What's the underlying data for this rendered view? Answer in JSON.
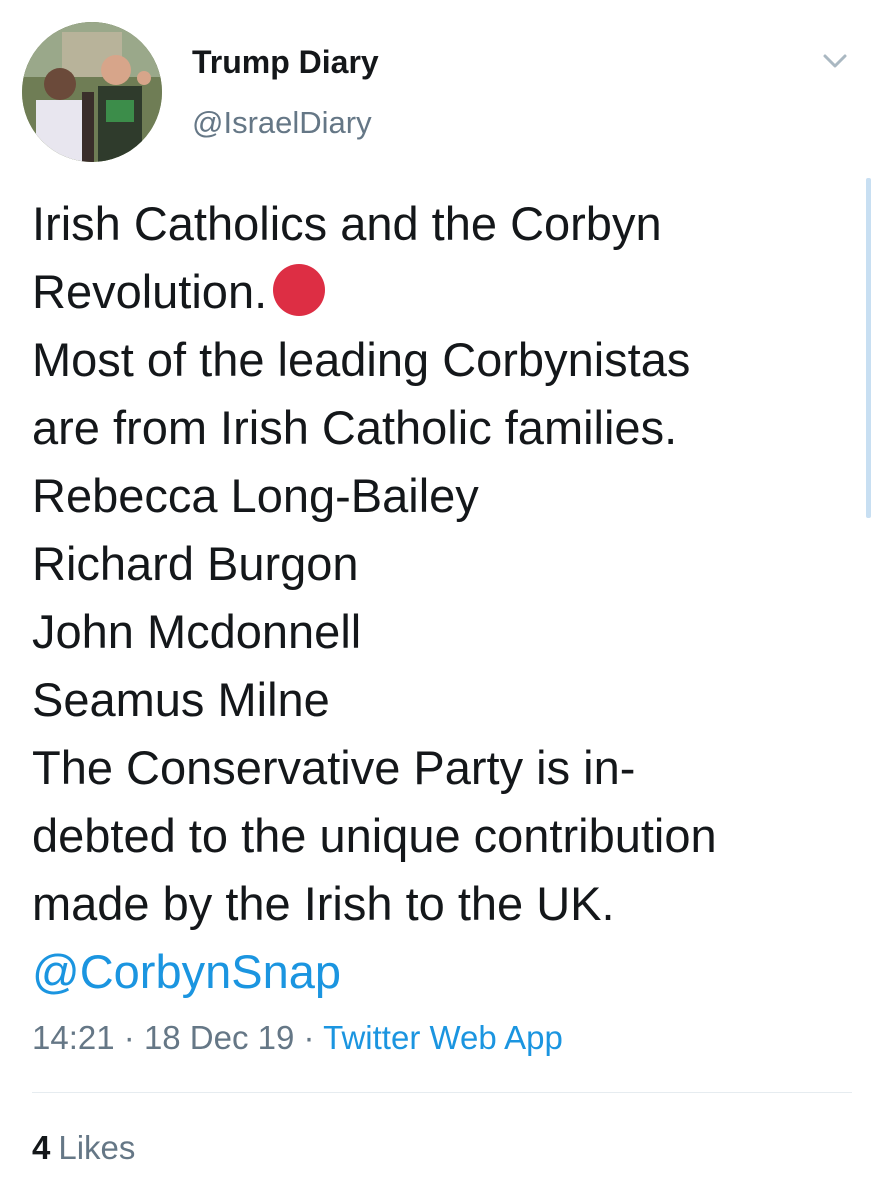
{
  "author": {
    "display_name": "Trump Diary",
    "handle": "@IsraelDiary"
  },
  "icons": {
    "menu": "chevron-down-icon",
    "emoji": "red-circle-icon"
  },
  "tweet": {
    "lines": [
      "Irish Catholics and the Corbyn",
      "Revolution.",
      "Most of the leading Corbynistas",
      "are from Irish Catholic families.",
      "Rebecca Long-Bailey",
      "Richard Burgon",
      "John Mcdonnell",
      "Seamus Milne",
      "The Conservative Party is in-",
      "debted to the unique contribution",
      "made by the Irish to the UK."
    ],
    "mention": "@CorbynSnap"
  },
  "meta": {
    "time": "14:21",
    "separator": "·",
    "date": "18 Dec 19",
    "source": "Twitter Web App"
  },
  "stats": {
    "likes_count": "4",
    "likes_label": "Likes"
  },
  "colors": {
    "accent": "#1b95e0",
    "secondary_text": "#657786",
    "primary_text": "#14171a",
    "emoji_red": "#dd2e44",
    "divider": "#e6ecf0"
  }
}
